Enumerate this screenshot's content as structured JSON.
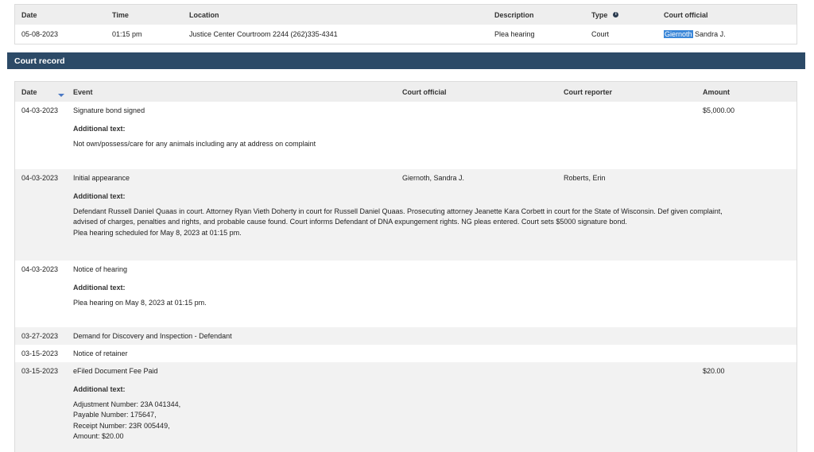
{
  "hearings": {
    "headers": {
      "date": "Date",
      "time": "Time",
      "location": "Location",
      "description": "Description",
      "type": "Type",
      "official": "Court official"
    },
    "row": {
      "date": "05-08-2023",
      "time": "01:15 pm",
      "location": "Justice Center Courtroom 2244 (262)335-4341",
      "description": "Plea hearing",
      "type": "Court",
      "official_highlight": "Giernoth",
      "official_rest": "Sandra J."
    }
  },
  "court_record": {
    "title": "Court record",
    "headers": {
      "date": "Date",
      "event": "Event",
      "official": "Court official",
      "reporter": "Court reporter",
      "amount": "Amount"
    },
    "additional_text_label": "Additional text:",
    "entries": [
      {
        "date": "04-03-2023",
        "event": "Signature bond signed",
        "official": "",
        "reporter": "",
        "amount": "$5,000.00",
        "text": [
          "Not own/possess/care for any animals including any at address on complaint"
        ]
      },
      {
        "date": "04-03-2023",
        "event": "Initial appearance",
        "official": "Giernoth, Sandra J.",
        "reporter": "Roberts, Erin",
        "amount": "",
        "text": [
          "Defendant Russell Daniel Quaas in court.  Attorney Ryan Vieth Doherty in court for Russell Daniel Quaas.  Prosecuting attorney Jeanette Kara Corbett in court for the State of Wisconsin. Def given complaint,",
          "advised of charges, penalties and rights, and probable cause found. Court informs Defendant of DNA expungement rights. NG pleas entered.  Court sets $5000 signature bond.",
          "Plea hearing scheduled for May 8, 2023 at 01:15 pm."
        ]
      },
      {
        "date": "04-03-2023",
        "event": "Notice of hearing",
        "official": "",
        "reporter": "",
        "amount": "",
        "text": [
          "Plea hearing on May 8, 2023 at 01:15 pm."
        ]
      },
      {
        "date": "03-27-2023",
        "event": "Demand for Discovery and Inspection - Defendant",
        "official": "",
        "reporter": "",
        "amount": "",
        "text": []
      },
      {
        "date": "03-15-2023",
        "event": "Notice of retainer",
        "official": "",
        "reporter": "",
        "amount": "",
        "text": []
      },
      {
        "date": "03-15-2023",
        "event": "eFiled Document Fee Paid",
        "official": "",
        "reporter": "",
        "amount": "$20.00",
        "text": [
          "Adjustment Number: 23A 041344,",
          "Payable Number: 175647,",
          "Receipt Number: 23R 005449,",
          "Amount: $20.00"
        ]
      }
    ]
  },
  "colors": {
    "section_bar": "#2c4a67",
    "highlight": "#3b87d8",
    "header_bg": "#eeeeee",
    "row_gray": "#f2f2f2"
  }
}
